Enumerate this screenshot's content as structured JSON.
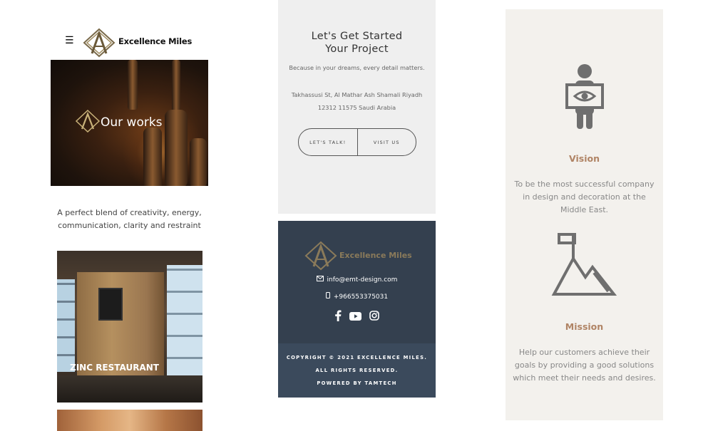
{
  "header": {
    "menu_icon": "hamburger-icon",
    "brand": "Excellence Miles"
  },
  "hero": {
    "title": "Our works"
  },
  "intro": {
    "tagline": "A perfect blend of creativity, energy, communication, clarity and restraint"
  },
  "works": [
    {
      "title": "ZINC RESTAURANT"
    },
    {
      "title": ""
    }
  ],
  "cta": {
    "title_line1": "Let's Get Started",
    "title_line2": "Your Project",
    "subtitle": "Because in your dreams, every detail matters.",
    "address_line1": "Takhassusi St, Al Mathar Ash Shamali Riyadh",
    "address_line2": "12312 11575 Saudi Arabia",
    "btn_talk": "LET'S TALK!",
    "btn_visit": "VISIT US"
  },
  "footer": {
    "brand": "Excellence Miles",
    "email": "info@emt-design.com",
    "phone": "+966553375031",
    "socials": [
      "facebook-icon",
      "youtube-icon",
      "instagram-icon"
    ],
    "copyright_line1": "COPYRIGHT © 2021 EXCELLENCE MILES.",
    "copyright_line2": "ALL RIGHTS RESERVED.",
    "copyright_line3": "POWERED BY TAMTECH"
  },
  "about": {
    "vision_title": "Vision",
    "vision_text": "To be the most successful company in design and decoration at the Middle East.",
    "mission_title": "Mission",
    "mission_text": "Help our customers achieve their goals by providing a good solutions which meet their needs and desires."
  },
  "colors": {
    "accent": "#b08465",
    "footer_bg": "#34404f",
    "copyright_bg": "#3b4a5c",
    "cta_bg": "#efefef",
    "about_bg": "#f3f1ed"
  }
}
